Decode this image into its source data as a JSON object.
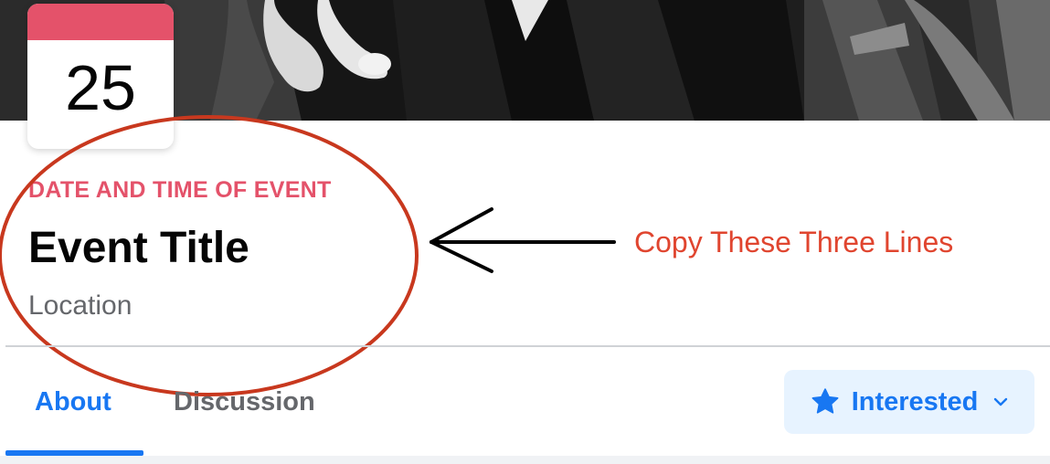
{
  "cover": {
    "icon": "cover-photo",
    "tone": "black-and-white"
  },
  "date_card": {
    "day": "25",
    "accent_color": "#e4526a"
  },
  "event": {
    "date_time": "DATE AND TIME OF EVENT",
    "title": "Event Title",
    "location": "Location"
  },
  "annotation": {
    "text": "Copy These Three Lines",
    "color": "#e0452f",
    "icons": [
      "ellipse-highlight",
      "arrow-left"
    ]
  },
  "tabs": [
    {
      "label": "About",
      "active": true
    },
    {
      "label": "Discussion",
      "active": false
    }
  ],
  "interested_button": {
    "label": "Interested",
    "icon": "star-icon",
    "dropdown_icon": "chevron-down-icon"
  },
  "colors": {
    "accent_blue": "#1877f2",
    "button_bg": "#e7f3ff",
    "secondary_text": "#65676b"
  }
}
